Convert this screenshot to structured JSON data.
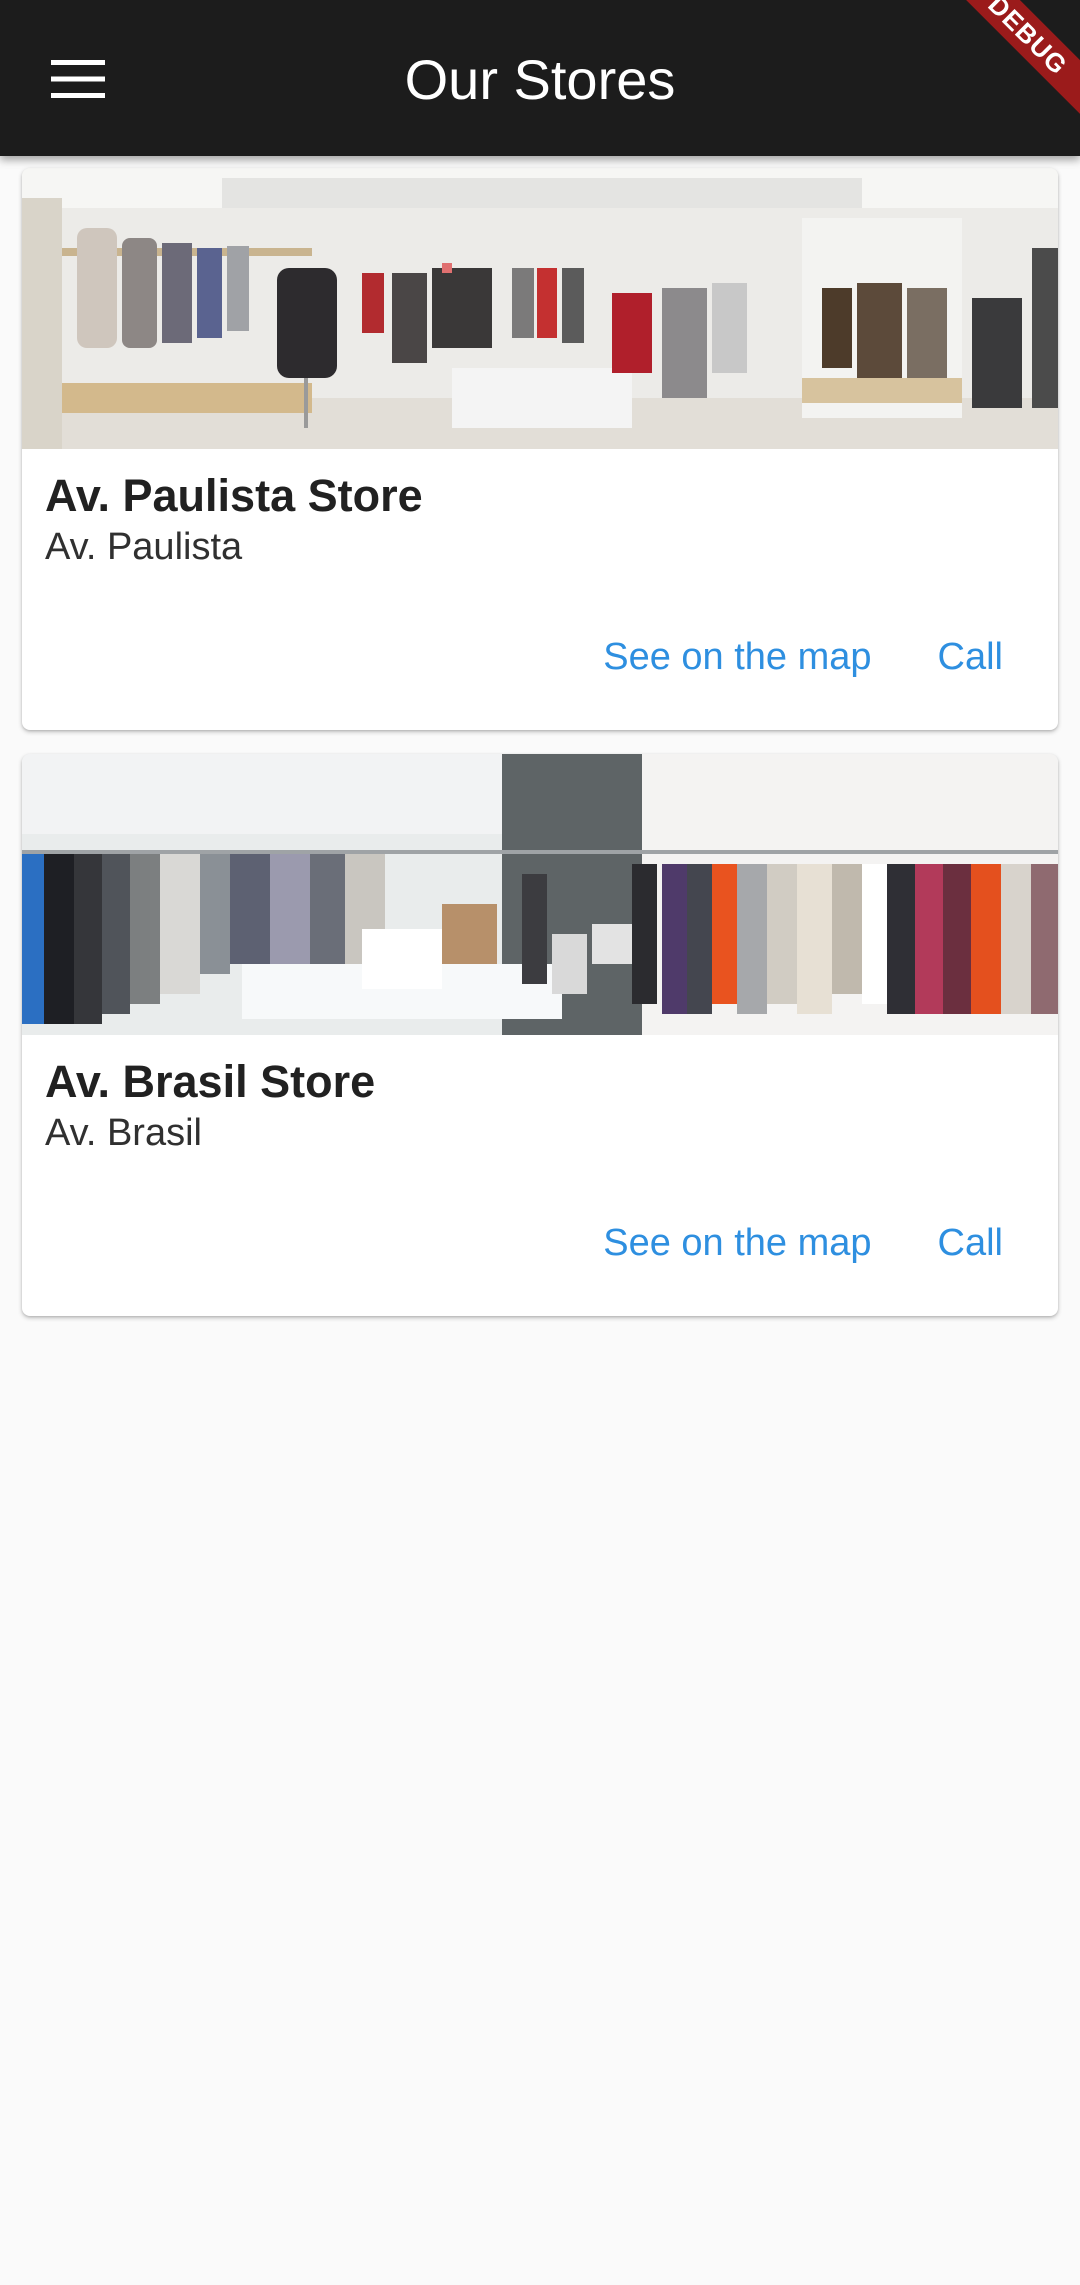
{
  "app_bar": {
    "title": "Our Stores",
    "menu_icon": "hamburger-menu-icon",
    "background": "#1c1c1c"
  },
  "debug_banner": {
    "label": "DEBUG",
    "color": "#9b1b1b"
  },
  "stores": [
    {
      "name": "Av. Paulista Store",
      "address": "Av. Paulista",
      "image_alt": "clothing store interior with racks of clothes",
      "map_button": "See on the map",
      "call_button": "Call"
    },
    {
      "name": "Av. Brasil Store",
      "address": "Av. Brasil",
      "image_alt": "clothing store interior with long clothing rack",
      "map_button": "See on the map",
      "call_button": "Call"
    }
  ],
  "colors": {
    "accent": "#2e8fe0",
    "page_background": "#fafafa",
    "card_background": "#ffffff"
  }
}
